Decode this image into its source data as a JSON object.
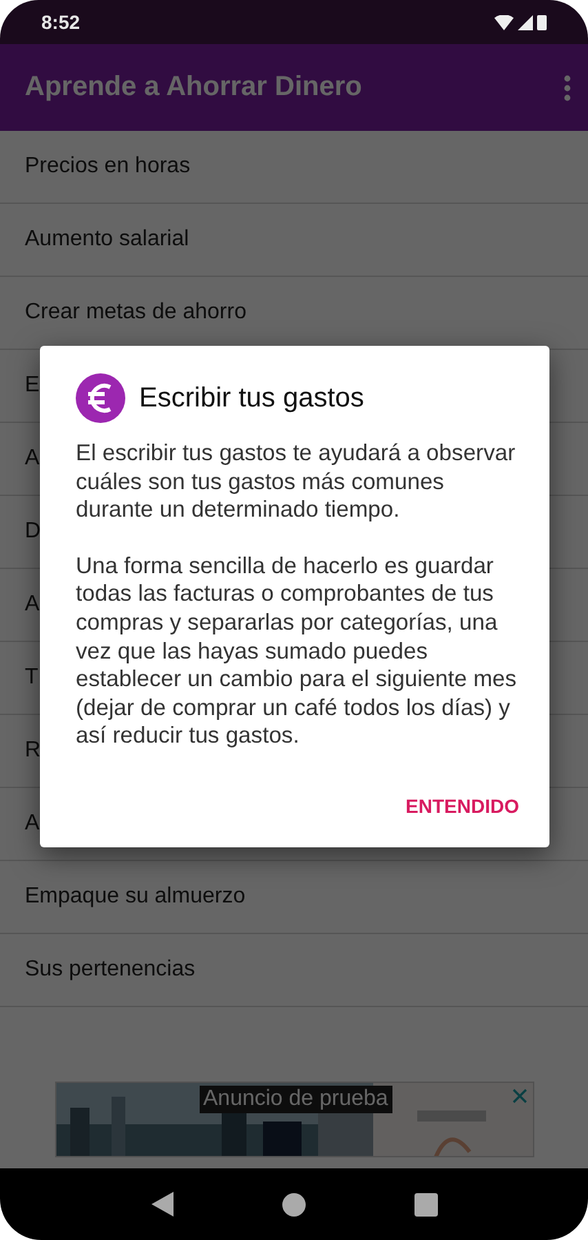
{
  "status_bar": {
    "time": "8:52"
  },
  "app_bar": {
    "title": "Aprende a Ahorrar Dinero"
  },
  "list": [
    {
      "label": "Precios en horas"
    },
    {
      "label": "Aumento salarial"
    },
    {
      "label": "Crear metas de ahorro"
    },
    {
      "label": "E"
    },
    {
      "label": "A"
    },
    {
      "label": "D"
    },
    {
      "label": "A"
    },
    {
      "label": "T"
    },
    {
      "label": "R"
    },
    {
      "label": "A"
    },
    {
      "label": "Empaque su almuerzo"
    },
    {
      "label": "Sus pertenencias"
    }
  ],
  "dialog": {
    "title": "Escribir tus gastos",
    "paragraphs": [
      "El escribir tus gastos te ayudará a observar cuáles son tus gastos más comunes durante un determinado tiempo.",
      "Una forma sencilla de hacerlo es guardar todas las facturas o comprobantes de tus compras y separarlas por categorías, una vez que las hayas sumado puedes establecer un cambio para el siguiente mes (dejar de comprar un café todos los días) y así reducir tus gastos."
    ],
    "button": "ENTENDIDO"
  },
  "ad": {
    "label": "Anuncio de prueba"
  }
}
